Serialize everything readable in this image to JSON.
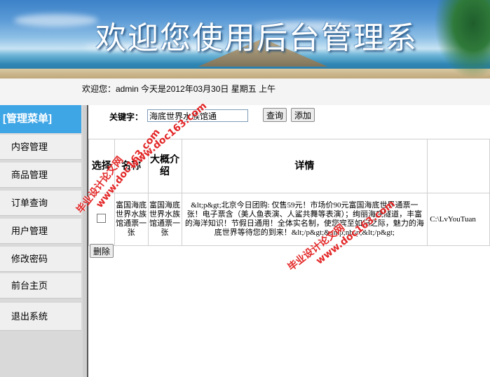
{
  "banner": {
    "title": "欢迎您使用后台管理系"
  },
  "status": {
    "text": "欢迎您：admin   今天是2012年03月30日   星期五   上午"
  },
  "sidebar": {
    "header": "[管理菜单]",
    "items": [
      {
        "label": "内容管理"
      },
      {
        "label": "商品管理"
      },
      {
        "label": "订单查询"
      },
      {
        "label": "用户管理"
      },
      {
        "label": "修改密码"
      },
      {
        "label": "前台主页"
      },
      {
        "label": "退出系统"
      }
    ]
  },
  "search": {
    "label": "关键字：",
    "value": "海底世界水族馆通",
    "query_label": "查询",
    "add_label": "添加"
  },
  "table": {
    "headers": {
      "select": "选择",
      "name": "名称",
      "intro": "大概介绍",
      "details": "详情"
    },
    "rows": [
      {
        "name": "富国海底世界水族馆通票一张",
        "intro": "富国海底世界水族馆通票一张",
        "details": "&lt;p&gt;北京今日团购: 仅售59元！市场价90元富国海底世界通票一张！电子票含（美人鱼表演、人鲨共舞等表演）；绚丽海底隧道，丰富的海洋知识！节假日通用！全体实名制，使您宾至如归之际，魅力的海底世界等待您的到来！&lt;/p&gt;&amp;nbsp;&lt;/p&gt;",
        "path": "C:\\LvYouTuan"
      }
    ],
    "delete_label": "删除"
  },
  "watermarks": [
    {
      "text": "毕业设计论文网"
    },
    {
      "text": "www.doc163.com"
    },
    {
      "text": "www.doc163.com"
    },
    {
      "text": "毕业设计论文网"
    },
    {
      "text": "www.doc163.com"
    }
  ]
}
